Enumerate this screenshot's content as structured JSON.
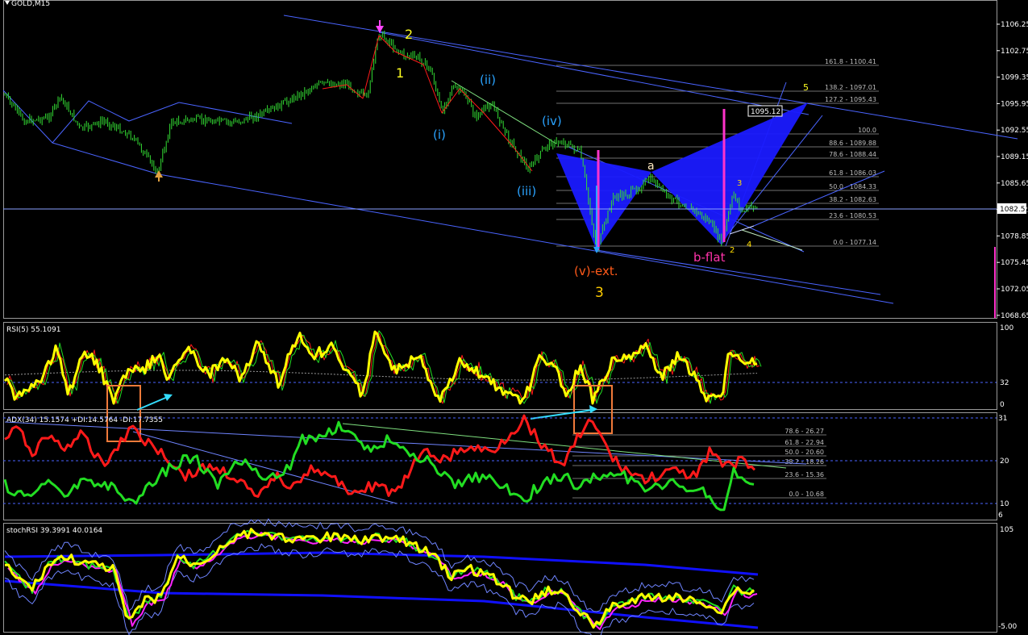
{
  "main_panel": {
    "title": "GOLD,M15",
    "price_ticks": [
      "1106.25",
      "1102.75",
      "1099.35",
      "1095.95",
      "1092.55",
      "1089.15",
      "1085.65",
      "1082.25",
      "1078.85",
      "1075.45",
      "1072.05",
      "1068.65"
    ],
    "current_price": "1082.51",
    "box_price": "1095.12",
    "fib_levels": [
      "161.8 - 1100.41",
      "138.2 - 1097.01",
      "127.2 - 1095.43",
      "100.0",
      "88.6 - 1089.88",
      "78.6 - 1088.44",
      "61.8 - 1086.03",
      "50.0 - 1084.33",
      "38.2 - 1082.63",
      "23.6 - 1080.53",
      "0.0 - 1077.14"
    ],
    "wave_labels": {
      "w1": "1",
      "w2": "2",
      "w3": "3",
      "w5": "5",
      "wi": "(i)",
      "wii": "(ii)",
      "wiii": "(iii)",
      "wiv": "(iv)",
      "vext": "(v)-ext.",
      "a": "a",
      "bflat": "b-flat",
      "s2": "2",
      "s3": "3",
      "s4": "4"
    }
  },
  "rsi_panel": {
    "title": "RSI(5) 55.1091",
    "ticks": [
      "100",
      "32",
      "0"
    ]
  },
  "adx_panel": {
    "title": "ADX(34) 15.1574 +DI:14.5764 -DI:17.7355",
    "ticks": [
      "31",
      "20",
      "10",
      "6"
    ],
    "fib_levels": [
      "78.6 - 26.27",
      "61.8 - 22.94",
      "50.0 - 20.60",
      "38.2 - 18.26",
      "23.6 - 15.36",
      "0.0 - 10.68"
    ]
  },
  "stoch_panel": {
    "title": "stochRSI 39.3991 40.0164",
    "ticks": [
      "105",
      "-5.00"
    ]
  },
  "colors": {
    "candle": "#33dd33",
    "trendline": "#4a64ff",
    "pattern": "#1a1aff",
    "pink": "#ff33cc",
    "yellow": "#ffff00",
    "cyan_label": "#2aa3ff",
    "orange_label": "#ff6600",
    "red": "#ff1a1a",
    "green": "#22dd22",
    "magenta": "#ff22ff",
    "blue": "#1010ff"
  }
}
